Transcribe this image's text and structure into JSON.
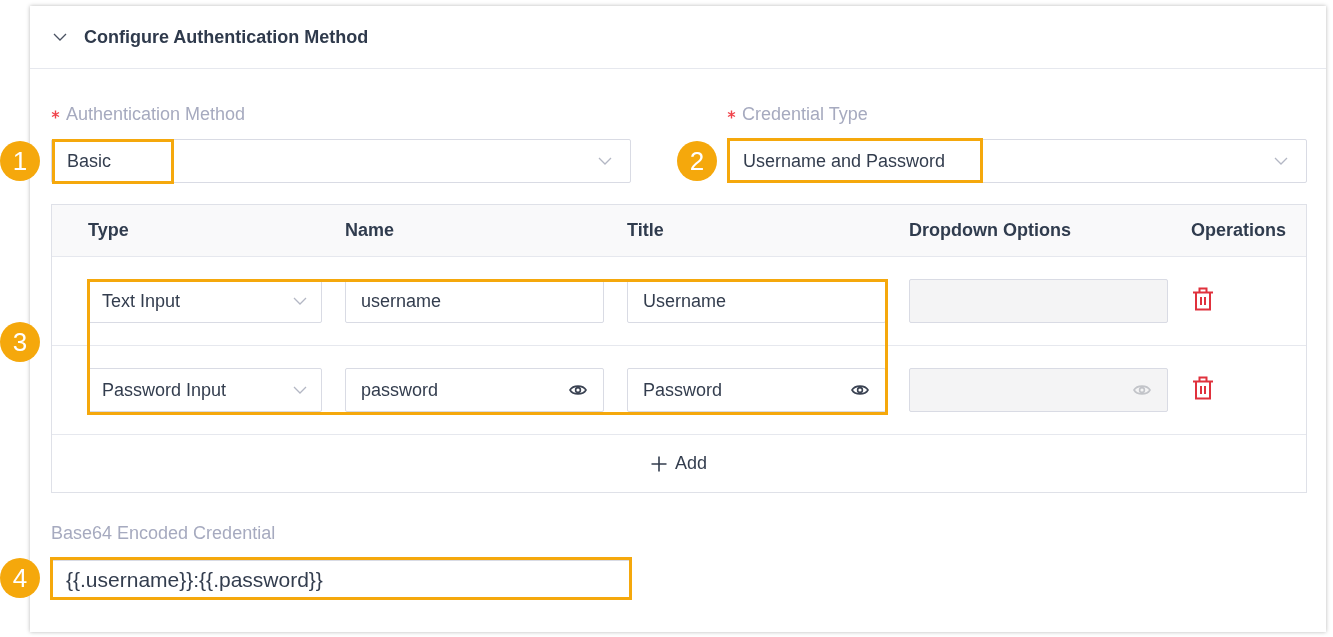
{
  "section": {
    "title": "Configure Authentication Method",
    "expanded": true
  },
  "fields": [
    {
      "label": "Authentication Method",
      "required": true,
      "value": "Basic"
    },
    {
      "label": "Credential Type",
      "required": true,
      "value": "Username and Password"
    }
  ],
  "table": {
    "columns": [
      "Type",
      "Name",
      "Title",
      "Dropdown Options",
      "Operations"
    ],
    "rows": [
      {
        "kind": "text",
        "type": "Text Input",
        "name": "username",
        "title": "Username",
        "dropdown_disabled": true
      },
      {
        "kind": "password",
        "type": "Password Input",
        "name": "password",
        "title": "Password",
        "dropdown_disabled": true
      }
    ],
    "add_button": "Add"
  },
  "encoded_credential": {
    "label": "Base64 Encoded Credential",
    "value": "{{.username}}:{{.password}}"
  },
  "callouts": [
    {
      "number": "1"
    },
    {
      "number": "2"
    },
    {
      "number": "3"
    },
    {
      "number": "4"
    }
  ]
}
